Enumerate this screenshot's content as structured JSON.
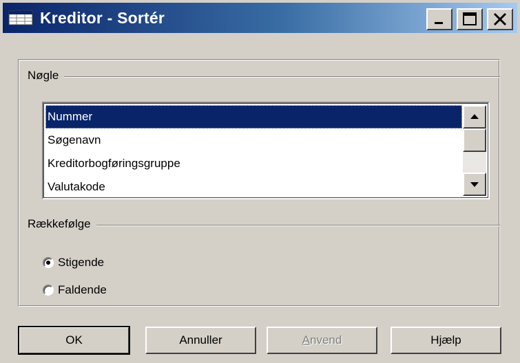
{
  "window": {
    "title": "Kreditor - Sortér",
    "minimize_icon": "minimize-icon",
    "maximize_icon": "maximize-icon",
    "close_icon": "close-icon"
  },
  "key_group": {
    "label": "Nøgle",
    "items": [
      {
        "label": "Nummer",
        "selected": true
      },
      {
        "label": "Søgenavn",
        "selected": false
      },
      {
        "label": "Kreditorbogføringsgruppe",
        "selected": false
      },
      {
        "label": "Valutakode",
        "selected": false
      }
    ]
  },
  "order_group": {
    "label": "Rækkefølge",
    "options": [
      {
        "label": "Stigende",
        "checked": true
      },
      {
        "label": "Faldende",
        "checked": false
      }
    ]
  },
  "buttons": {
    "ok": "OK",
    "cancel": "Annuller",
    "apply": "Anvend",
    "help": "Hjælp"
  },
  "colors": {
    "title_start": "#0a246a",
    "title_end": "#a6caf0",
    "selection": "#0a246a",
    "face": "#d4d0c8"
  }
}
